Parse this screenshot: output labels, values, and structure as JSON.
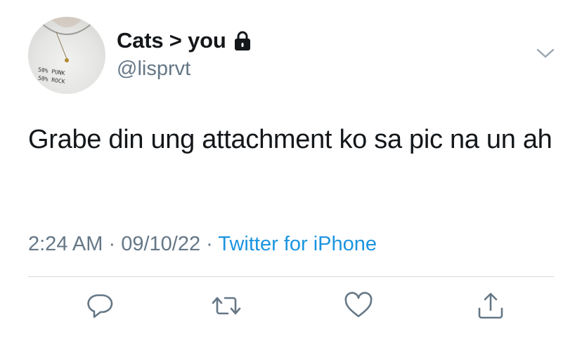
{
  "tweet": {
    "display_name": "Cats > you",
    "handle": "@lisprvt",
    "protected_icon": "lock-icon",
    "avatar_text": [
      "50% PUNK",
      "50% ROCK"
    ],
    "text": "Grabe din ung attachment ko sa pic na un ah",
    "time": "2:24 AM",
    "separator": "·",
    "date": "09/10/22",
    "source": "Twitter for iPhone",
    "menu_icon": "chevron-down-icon"
  },
  "actions": [
    {
      "name": "reply",
      "icon": "reply-bubble-icon"
    },
    {
      "name": "retweet",
      "icon": "retweet-icon"
    },
    {
      "name": "like",
      "icon": "heart-icon"
    },
    {
      "name": "share",
      "icon": "share-icon"
    }
  ],
  "colors": {
    "text_primary": "#14171a",
    "text_secondary": "#657786",
    "link": "#1b95e0",
    "divider": "#d5dbe0"
  }
}
